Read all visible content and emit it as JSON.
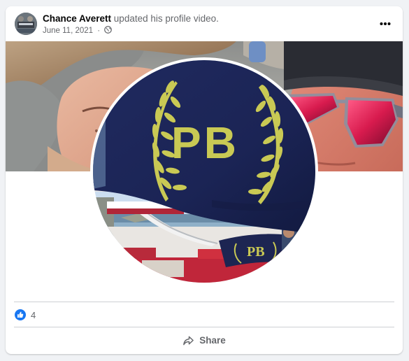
{
  "post": {
    "author": "Chance Averett",
    "action_text": " updated his profile video.",
    "date": "June 11, 2021",
    "meta_separator": " · ",
    "privacy_icon": "globe-icon",
    "more_icon": "more-horizontal-icon"
  },
  "media": {
    "flag_text": "PB"
  },
  "reactions": {
    "icon": "like-icon",
    "count": "4"
  },
  "actions": {
    "share_label": "Share",
    "share_icon": "share-icon"
  },
  "colors": {
    "accent": "#1877f2",
    "flag_navy": "#1b2455",
    "flag_yellow": "#c9c954",
    "secondary_text": "#65676b"
  }
}
